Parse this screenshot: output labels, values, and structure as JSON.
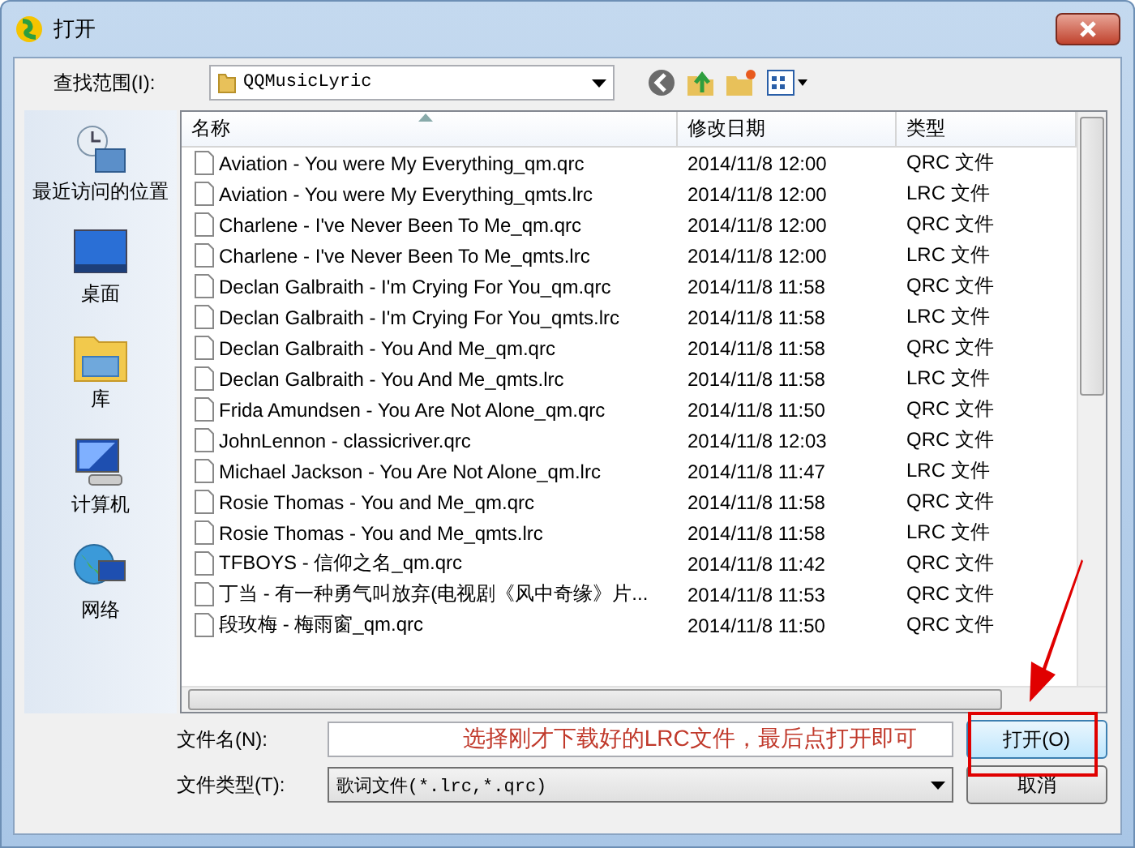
{
  "window": {
    "title": "打开"
  },
  "look_in": {
    "label": "查找范围(I):",
    "value": "QQMusicLyric"
  },
  "places": [
    {
      "label": "最近访问的位置",
      "kind": "recent"
    },
    {
      "label": "桌面",
      "kind": "desktop"
    },
    {
      "label": "库",
      "kind": "library"
    },
    {
      "label": "计算机",
      "kind": "computer"
    },
    {
      "label": "网络",
      "kind": "network"
    }
  ],
  "file_list": {
    "columns": [
      "名称",
      "修改日期",
      "类型"
    ],
    "rows": [
      {
        "name": "Aviation - You were My Everything_qm.qrc",
        "modified": "2014/11/8 12:00",
        "type": "QRC 文件"
      },
      {
        "name": "Aviation - You were My Everything_qmts.lrc",
        "modified": "2014/11/8 12:00",
        "type": "LRC 文件"
      },
      {
        "name": "Charlene - I've Never Been To Me_qm.qrc",
        "modified": "2014/11/8 12:00",
        "type": "QRC 文件"
      },
      {
        "name": "Charlene - I've Never Been To Me_qmts.lrc",
        "modified": "2014/11/8 12:00",
        "type": "LRC 文件"
      },
      {
        "name": "Declan Galbraith - I'm Crying For You_qm.qrc",
        "modified": "2014/11/8 11:58",
        "type": "QRC 文件"
      },
      {
        "name": "Declan Galbraith - I'm Crying For You_qmts.lrc",
        "modified": "2014/11/8 11:58",
        "type": "LRC 文件"
      },
      {
        "name": "Declan Galbraith - You And Me_qm.qrc",
        "modified": "2014/11/8 11:58",
        "type": "QRC 文件"
      },
      {
        "name": "Declan Galbraith - You And Me_qmts.lrc",
        "modified": "2014/11/8 11:58",
        "type": "LRC 文件"
      },
      {
        "name": "Frida Amundsen - You Are Not Alone_qm.qrc",
        "modified": "2014/11/8 11:50",
        "type": "QRC 文件"
      },
      {
        "name": "JohnLennon - classicriver.qrc",
        "modified": "2014/11/8 12:03",
        "type": "QRC 文件"
      },
      {
        "name": "Michael Jackson - You Are Not Alone_qm.lrc",
        "modified": "2014/11/8 11:47",
        "type": "LRC 文件"
      },
      {
        "name": "Rosie Thomas - You and Me_qm.qrc",
        "modified": "2014/11/8 11:58",
        "type": "QRC 文件"
      },
      {
        "name": "Rosie Thomas - You and Me_qmts.lrc",
        "modified": "2014/11/8 11:58",
        "type": "LRC 文件"
      },
      {
        "name": "TFBOYS - 信仰之名_qm.qrc",
        "modified": "2014/11/8 11:42",
        "type": "QRC 文件"
      },
      {
        "name": "丁当 - 有一种勇气叫放弃(电视剧《风中奇缘》片...",
        "modified": "2014/11/8 11:53",
        "type": "QRC 文件"
      },
      {
        "name": "段玫梅 - 梅雨窗_qm.qrc",
        "modified": "2014/11/8 11:50",
        "type": "QRC 文件"
      }
    ]
  },
  "file_name": {
    "label": "文件名(N):"
  },
  "file_type": {
    "label": "文件类型(T):",
    "value": "歌词文件(*.lrc,*.qrc)"
  },
  "buttons": [
    "打开(O)",
    "取消"
  ],
  "annotation": {
    "text": "选择刚才下载好的LRC文件，最后点打开即可"
  }
}
